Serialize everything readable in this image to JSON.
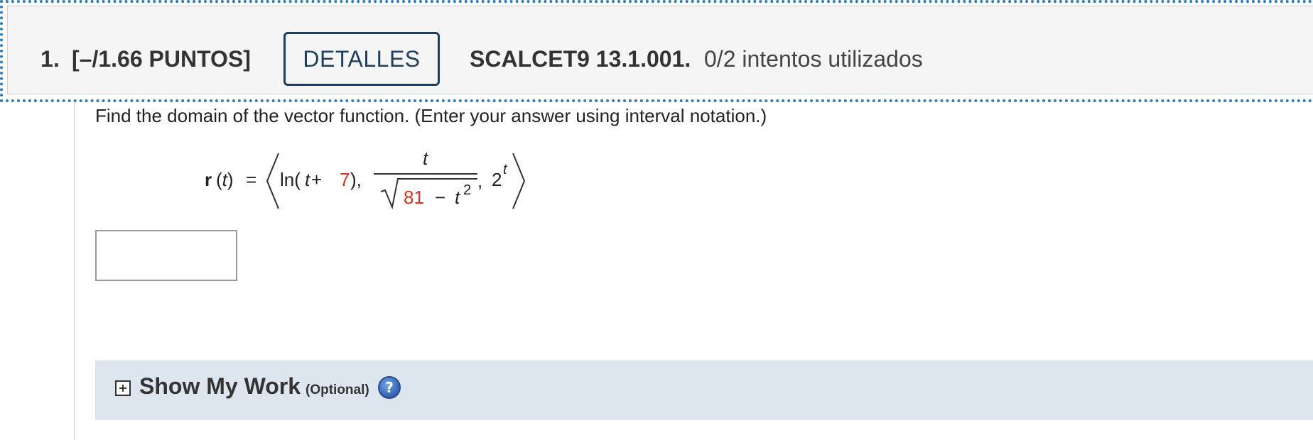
{
  "header": {
    "number": "1.",
    "points": "[–/1.66 PUNTOS]",
    "details_label": "DETALLES",
    "code": "SCALCET9 13.1.001.",
    "attempts": "0/2 intentos utilizados"
  },
  "question": {
    "prompt": "Find the domain of the vector function. (Enter your answer using interval notation.)",
    "formula": {
      "lhs_bold": "r",
      "lhs_arg": "(t)",
      "equals": "=",
      "ln": "ln(",
      "t1": "t",
      "plus": " + ",
      "seven": "7",
      "close_comma": "),",
      "numerator": "t",
      "eighty_one": "81",
      "minus": "−",
      "t2": "t",
      "sq": "2",
      "comma2": ",",
      "two": "2",
      "exp": "t"
    },
    "answer_value": "",
    "answer_placeholder": ""
  },
  "work": {
    "title": "Show My Work",
    "optional": "(Optional)",
    "help_icon_glyph": "?"
  },
  "icons": {
    "expand": "plus-box-icon",
    "help": "help-icon",
    "angle_brackets": "angle-bracket"
  },
  "colors": {
    "accent_dotted": "#2f7ab8",
    "button_border": "#1f3f5e",
    "highlight_red": "#e0301e",
    "work_bar_bg": "#dde6ee"
  }
}
